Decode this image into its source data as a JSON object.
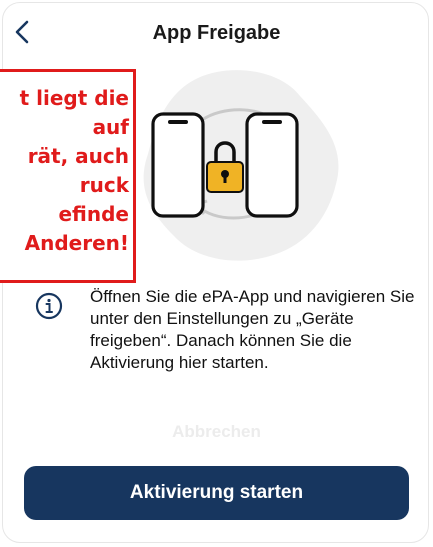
{
  "header": {
    "title": "App Freigabe",
    "back_icon": "chevron-left-icon"
  },
  "illustration": {
    "icon": "two-phones-lock-sync-icon",
    "lock_color": "#f0b325"
  },
  "overlay": {
    "lines": [
      "t liegt die",
      "auf",
      "rät, auch",
      "ruck",
      "efinde",
      "Anderen!"
    ],
    "color": "#e01b1b"
  },
  "info": {
    "icon": "info-icon",
    "text": "Öffnen Sie die ePA-App und navigieren Sie unter den Einstellungen zu „Geräte freigeben“. Danach können Sie die Aktivierung hier starten."
  },
  "actions": {
    "cancel_label": "Abbrechen",
    "start_label": "Aktivierung starten",
    "primary_color": "#17365f"
  }
}
